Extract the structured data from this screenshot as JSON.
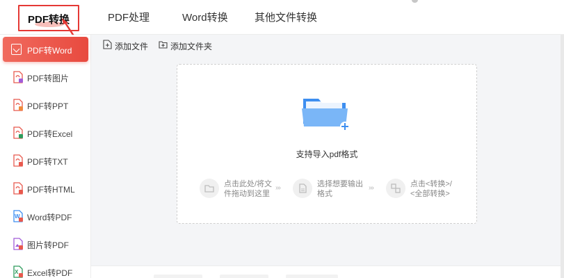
{
  "top_tabs": [
    {
      "label": "PDF转换"
    },
    {
      "label": "PDF处理"
    },
    {
      "label": "Word转换"
    },
    {
      "label": "其他文件转换"
    }
  ],
  "sidebar": {
    "items": [
      {
        "label": "PDF转Word",
        "icon": "pdf-to-word-icon",
        "active": true
      },
      {
        "label": "PDF转图片",
        "icon": "pdf-to-image-icon"
      },
      {
        "label": "PDF转PPT",
        "icon": "pdf-to-ppt-icon"
      },
      {
        "label": "PDF转Excel",
        "icon": "pdf-to-excel-icon"
      },
      {
        "label": "PDF转TXT",
        "icon": "pdf-to-txt-icon"
      },
      {
        "label": "PDF转HTML",
        "icon": "pdf-to-html-icon"
      },
      {
        "label": "Word转PDF",
        "icon": "word-to-pdf-icon"
      },
      {
        "label": "图片转PDF",
        "icon": "image-to-pdf-icon"
      },
      {
        "label": "Excel转PDF",
        "icon": "excel-to-pdf-icon"
      }
    ]
  },
  "toolbar": {
    "add_file": "添加文件",
    "add_folder": "添加文件夹"
  },
  "dropzone": {
    "support_text": "支持导入pdf格式",
    "steps": [
      {
        "line1": "点击此处/将文",
        "line2": "件拖动到这里"
      },
      {
        "line1": "选择想要输出",
        "line2": "格式"
      },
      {
        "line1": "点击<转换>/",
        "line2": "<全部转换>"
      }
    ],
    "separator": "›››"
  },
  "colors": {
    "accent": "#e84a3f",
    "folder_blue": "#3d8ef0",
    "highlight_box": "#e53935"
  }
}
